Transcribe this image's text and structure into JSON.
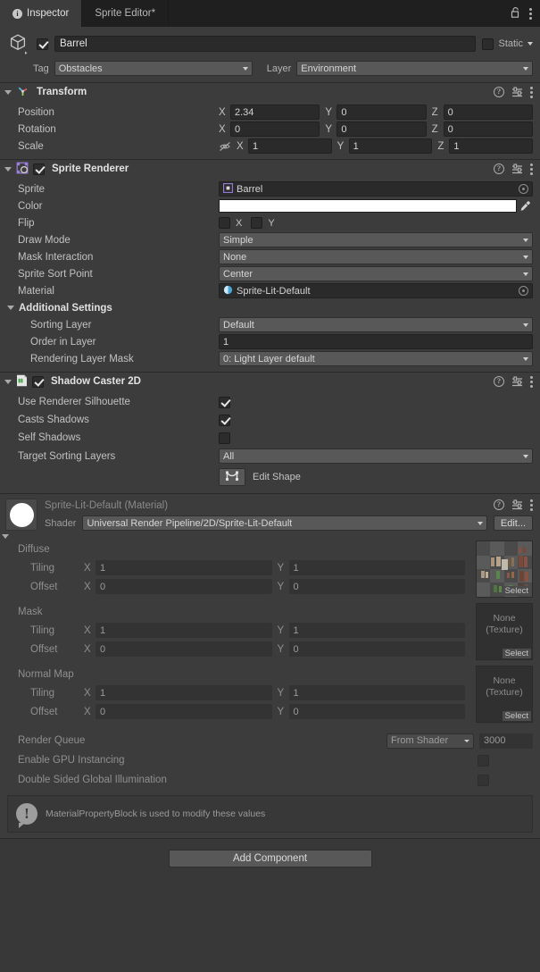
{
  "window": {
    "tabs": [
      {
        "label": "Inspector",
        "icon": "info-icon",
        "active": true
      },
      {
        "label": "Sprite Editor*",
        "icon": "",
        "active": false
      }
    ],
    "lock_icon": "lock-open-icon",
    "menu_icon": "kebab-menu-icon"
  },
  "object_header": {
    "icon": "game-object-cube-icon",
    "enabled": true,
    "name": "Barrel",
    "static_label": "Static",
    "static_checked": false,
    "tag_label": "Tag",
    "tag_value": "Obstacles",
    "layer_label": "Layer",
    "layer_value": "Environment"
  },
  "transform": {
    "title": "Transform",
    "icon": "transform-axis-icon",
    "expanded": true,
    "rows": [
      {
        "label": "Position",
        "x": "2.34",
        "y": "0",
        "z": "0",
        "has_link": false
      },
      {
        "label": "Rotation",
        "x": "0",
        "y": "0",
        "z": "0",
        "has_link": false
      },
      {
        "label": "Scale",
        "x": "1",
        "y": "1",
        "z": "1",
        "has_link": true,
        "link_icon": "constrain-proportions-off-icon"
      }
    ],
    "axis": {
      "x": "X",
      "y": "Y",
      "z": "Z"
    }
  },
  "sprite_renderer": {
    "title": "Sprite Renderer",
    "icon": "sprite-renderer-icon",
    "enabled": true,
    "expanded": true,
    "sprite_label": "Sprite",
    "sprite_value": "Barrel",
    "color_label": "Color",
    "color_value": "#FFFFFF",
    "eyedropper_icon": "eyedropper-icon",
    "flip_label": "Flip",
    "flip_x_label": "X",
    "flip_y_label": "Y",
    "flip_x": false,
    "flip_y": false,
    "draw_mode_label": "Draw Mode",
    "draw_mode_value": "Simple",
    "mask_interaction_label": "Mask Interaction",
    "mask_interaction_value": "None",
    "sort_point_label": "Sprite Sort Point",
    "sort_point_value": "Center",
    "material_label": "Material",
    "material_value": "Sprite-Lit-Default",
    "additional_settings_label": "Additional Settings",
    "sorting_layer_label": "Sorting Layer",
    "sorting_layer_value": "Default",
    "order_in_layer_label": "Order in Layer",
    "order_in_layer_value": "1",
    "rendering_layer_mask_label": "Rendering Layer Mask",
    "rendering_layer_mask_value": "0: Light Layer default"
  },
  "shadow_caster": {
    "title": "Shadow Caster 2D",
    "icon": "script-icon",
    "enabled": true,
    "expanded": true,
    "use_renderer_silhouette_label": "Use Renderer Silhouette",
    "use_renderer_silhouette": true,
    "casts_shadows_label": "Casts Shadows",
    "casts_shadows": true,
    "self_shadows_label": "Self Shadows",
    "self_shadows": false,
    "target_sorting_layers_label": "Target Sorting Layers",
    "target_sorting_layers_value": "All",
    "edit_shape_label": "Edit Shape",
    "edit_shape_icon": "edit-shape-icon"
  },
  "material": {
    "title": "Sprite-Lit-Default (Material)",
    "preview_icon": "material-sphere-preview",
    "shader_label": "Shader",
    "shader_value": "Universal Render Pipeline/2D/Sprite-Lit-Default",
    "edit_button_label": "Edit...",
    "textures": [
      {
        "name": "Diffuse",
        "tiling_label": "Tiling",
        "tiling_x": "1",
        "tiling_y": "1",
        "offset_label": "Offset",
        "offset_x": "0",
        "offset_y": "0",
        "slot_value": "",
        "slot_sub": "",
        "has_preview": true,
        "select_label": "Select"
      },
      {
        "name": "Mask",
        "tiling_label": "Tiling",
        "tiling_x": "1",
        "tiling_y": "1",
        "offset_label": "Offset",
        "offset_x": "0",
        "offset_y": "0",
        "slot_value": "None",
        "slot_sub": "(Texture)",
        "has_preview": false,
        "select_label": "Select"
      },
      {
        "name": "Normal Map",
        "tiling_label": "Tiling",
        "tiling_x": "1",
        "tiling_y": "1",
        "offset_label": "Offset",
        "offset_x": "0",
        "offset_y": "0",
        "slot_value": "None",
        "slot_sub": "(Texture)",
        "has_preview": false,
        "select_label": "Select"
      }
    ],
    "axis": {
      "x": "X",
      "y": "Y"
    },
    "render_queue_label": "Render Queue",
    "render_queue_mode": "From Shader",
    "render_queue_value": "3000",
    "gpu_instancing_label": "Enable GPU Instancing",
    "gpu_instancing": false,
    "double_sided_gi_label": "Double Sided Global Illumination",
    "double_sided_gi": false,
    "info_message": "MaterialPropertyBlock is used to modify these values",
    "info_icon": "warning-icon"
  },
  "footer": {
    "add_component_label": "Add Component"
  },
  "colors": {
    "panel_bg": "#383838",
    "component_bg": "#3c3c3c",
    "tabbar_bg": "#1f1f1f",
    "field_bg": "#2a2a2a",
    "dropdown_bg": "#585858",
    "sprite_icon_accent": "#9a7fd8",
    "script_icon_accent": "#5fb85f",
    "material_icon_accent": "#4aa8d8",
    "text": "#c4c4c4"
  }
}
